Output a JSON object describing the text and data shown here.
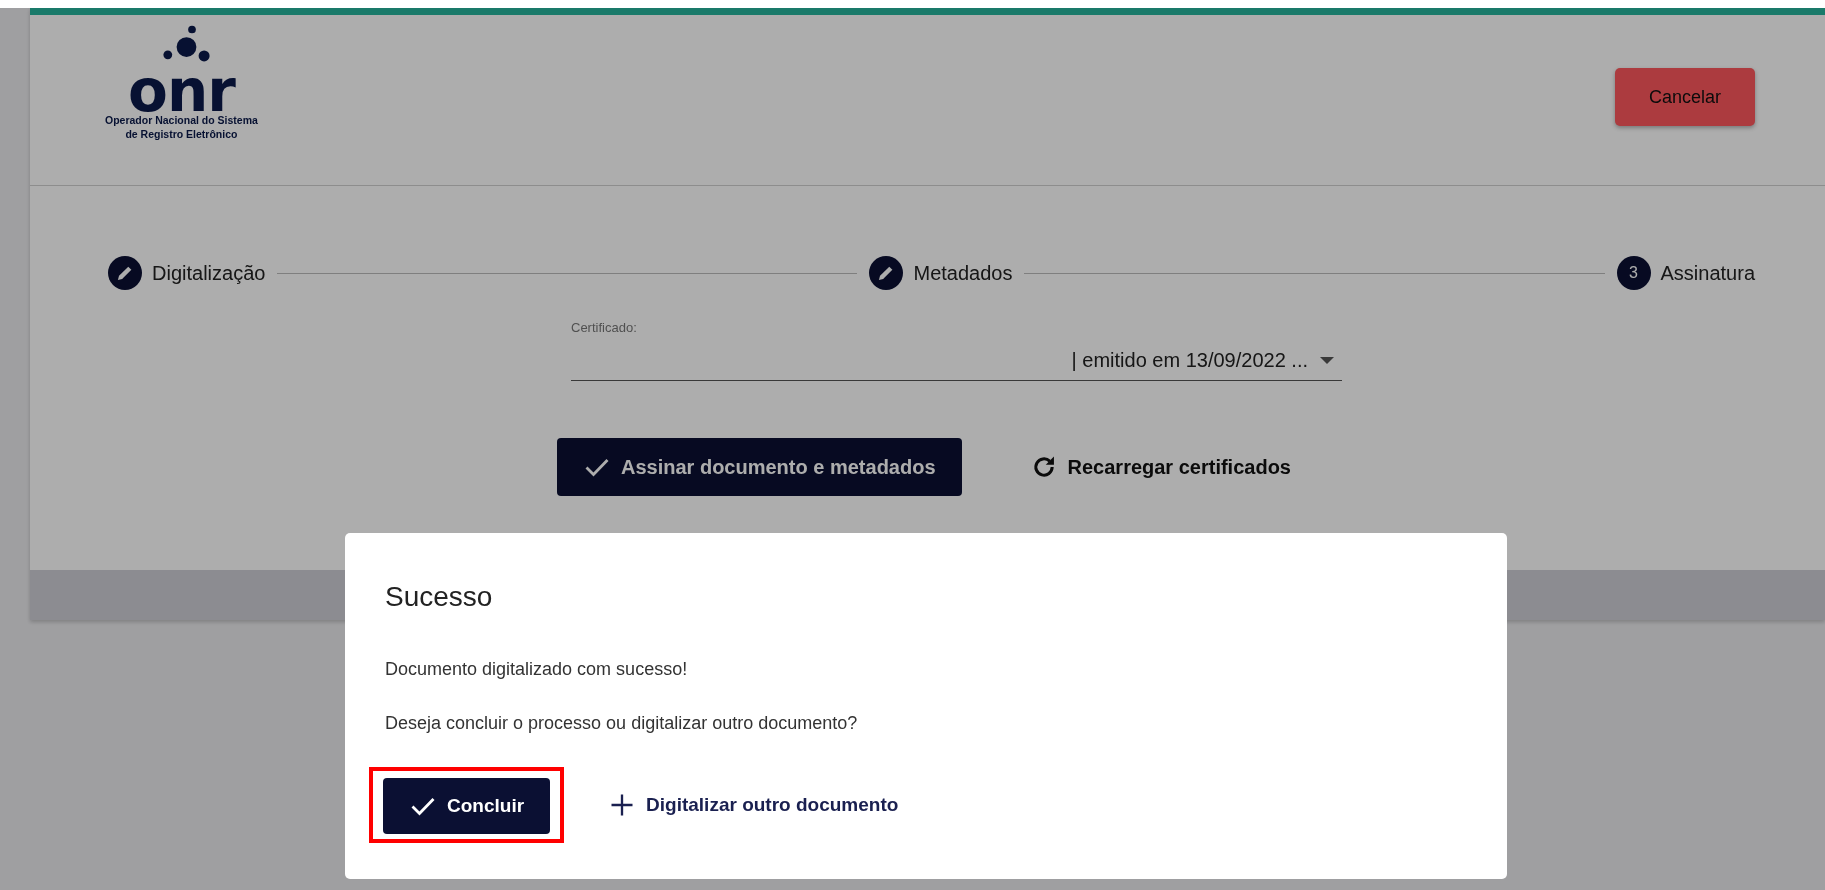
{
  "header": {
    "logo": {
      "wordmark": "onr",
      "tagline_lines": [
        "Operador Nacional do Sistema",
        "de Registro Eletrônico"
      ]
    },
    "cancel_button": "Cancelar"
  },
  "stepper": [
    {
      "kind": "edit",
      "label": "Digitalização"
    },
    {
      "kind": "edit",
      "label": "Metadados"
    },
    {
      "kind": "number",
      "number": "3",
      "label": "Assinatura"
    }
  ],
  "certificate_field": {
    "label": "Certificado:",
    "value": "| emitido em 13/09/2022 ..."
  },
  "actions": [
    {
      "kind": "check",
      "label": "Assinar documento e metadados"
    },
    {
      "kind": "reload",
      "label": "Recarregar certificados"
    }
  ],
  "dialog": {
    "title": "Sucesso",
    "messages": [
      "Documento digitalizado com sucesso!",
      "Deseja concluir o processo ou digitalizar outro documento?"
    ],
    "actions": [
      {
        "kind": "check",
        "label": "Concluir",
        "highlighted": true
      },
      {
        "kind": "plus",
        "label": "Digitalizar outro documento",
        "highlighted": false
      }
    ]
  }
}
